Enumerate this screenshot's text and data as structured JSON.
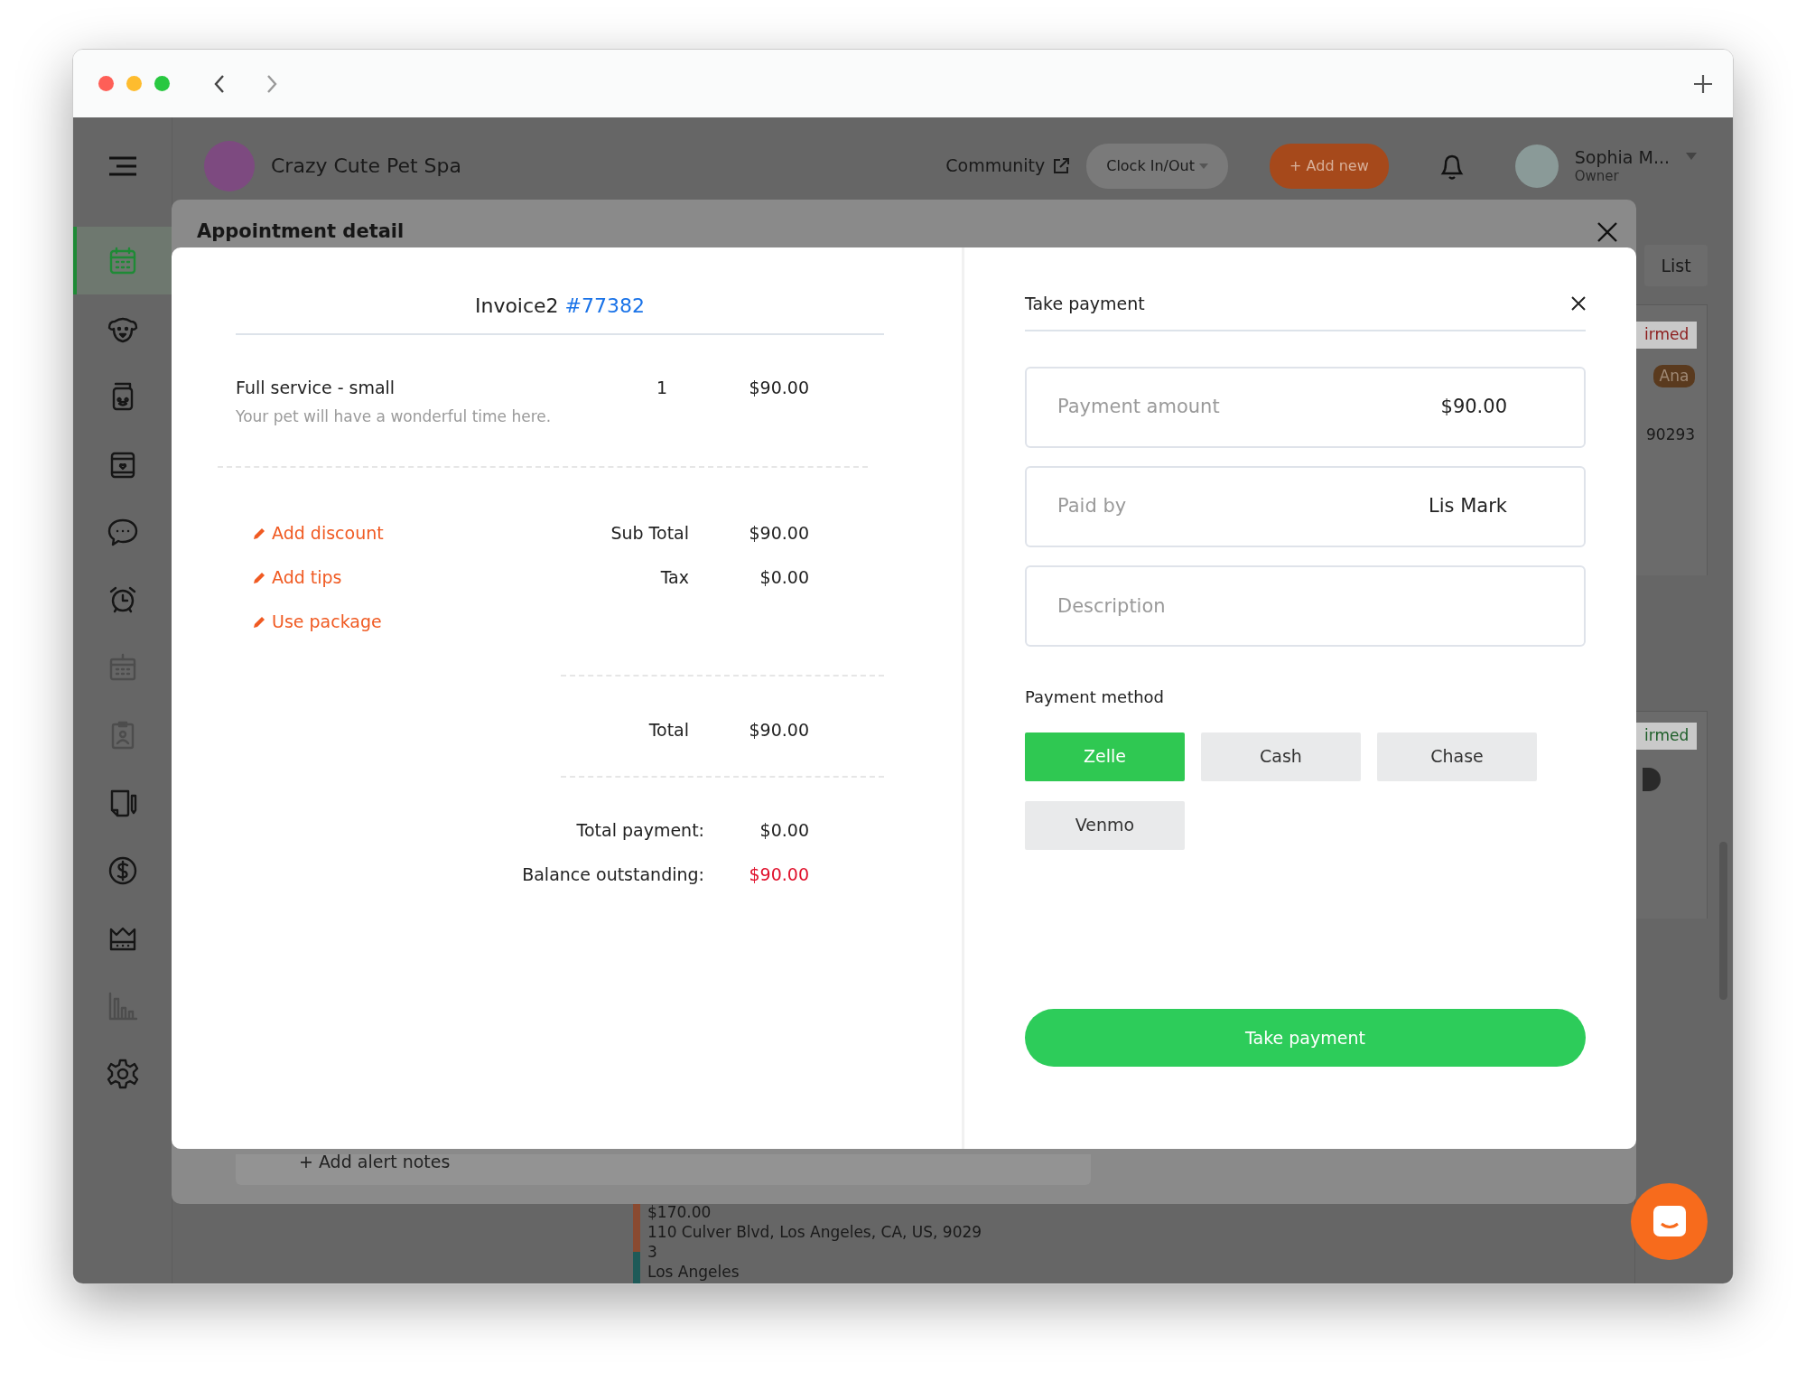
{
  "header": {
    "business_name": "Crazy Cute Pet Spa",
    "community": "Community",
    "clock": "Clock In/Out",
    "add_new": "+ Add new",
    "user": {
      "name": "Sophia M...",
      "role": "Owner"
    }
  },
  "sidebar": {
    "items": [
      {
        "selected": true,
        "disabled": false
      },
      {
        "selected": false,
        "disabled": false
      },
      {
        "selected": false,
        "disabled": false
      },
      {
        "selected": false,
        "disabled": false
      },
      {
        "selected": false,
        "disabled": false
      },
      {
        "selected": false,
        "disabled": false
      },
      {
        "selected": false,
        "disabled": true
      },
      {
        "selected": false,
        "disabled": true
      },
      {
        "selected": false,
        "disabled": false
      },
      {
        "selected": false,
        "disabled": false
      },
      {
        "selected": false,
        "disabled": false
      },
      {
        "selected": false,
        "disabled": true
      },
      {
        "selected": false,
        "disabled": false
      }
    ]
  },
  "background": {
    "view_tab": "List",
    "badges": [
      {
        "text": "irmed",
        "color": "#8c1c1c"
      },
      {
        "text": "irmed",
        "color": "#1d5e28"
      }
    ],
    "staff_tag": "Ana",
    "zip": "90293",
    "appointment": {
      "price": "$170.00",
      "address": "110 Culver Blvd, Los Angeles, CA, US, 9029",
      "address_end": "3",
      "city": "Los Angeles"
    }
  },
  "modal": {
    "title": "Appointment detail",
    "note": "+ Add alert notes",
    "invoice": {
      "title": "Invoice2",
      "number": "#77382",
      "items": [
        {
          "name": "Full service - small",
          "description": "Your pet will have a wonderful time here.",
          "quantity": "1",
          "price": "$90.00"
        }
      ],
      "actions": [
        "Add discount",
        "Add tips",
        "Use package"
      ],
      "subtotal_label": "Sub Total",
      "subtotal": "$90.00",
      "tax_label": "Tax",
      "tax": "$0.00",
      "total_label": "Total",
      "total": "$90.00",
      "total_payment_label": "Total payment:",
      "total_payment": "$0.00",
      "balance_label": "Balance outstanding:",
      "balance": "$90.00"
    },
    "payment": {
      "title": "Take payment",
      "fields": [
        {
          "label": "Payment amount",
          "value": "$90.00"
        },
        {
          "label": "Paid by",
          "value": "Lis Mark"
        },
        {
          "placeholder": "Description"
        }
      ],
      "method_label": "Payment method",
      "methods": [
        {
          "label": "Zelle",
          "selected": true
        },
        {
          "label": "Cash",
          "selected": false
        },
        {
          "label": "Chase",
          "selected": false
        },
        {
          "label": "Venmo",
          "selected": false
        }
      ],
      "submit": "Take payment"
    }
  }
}
